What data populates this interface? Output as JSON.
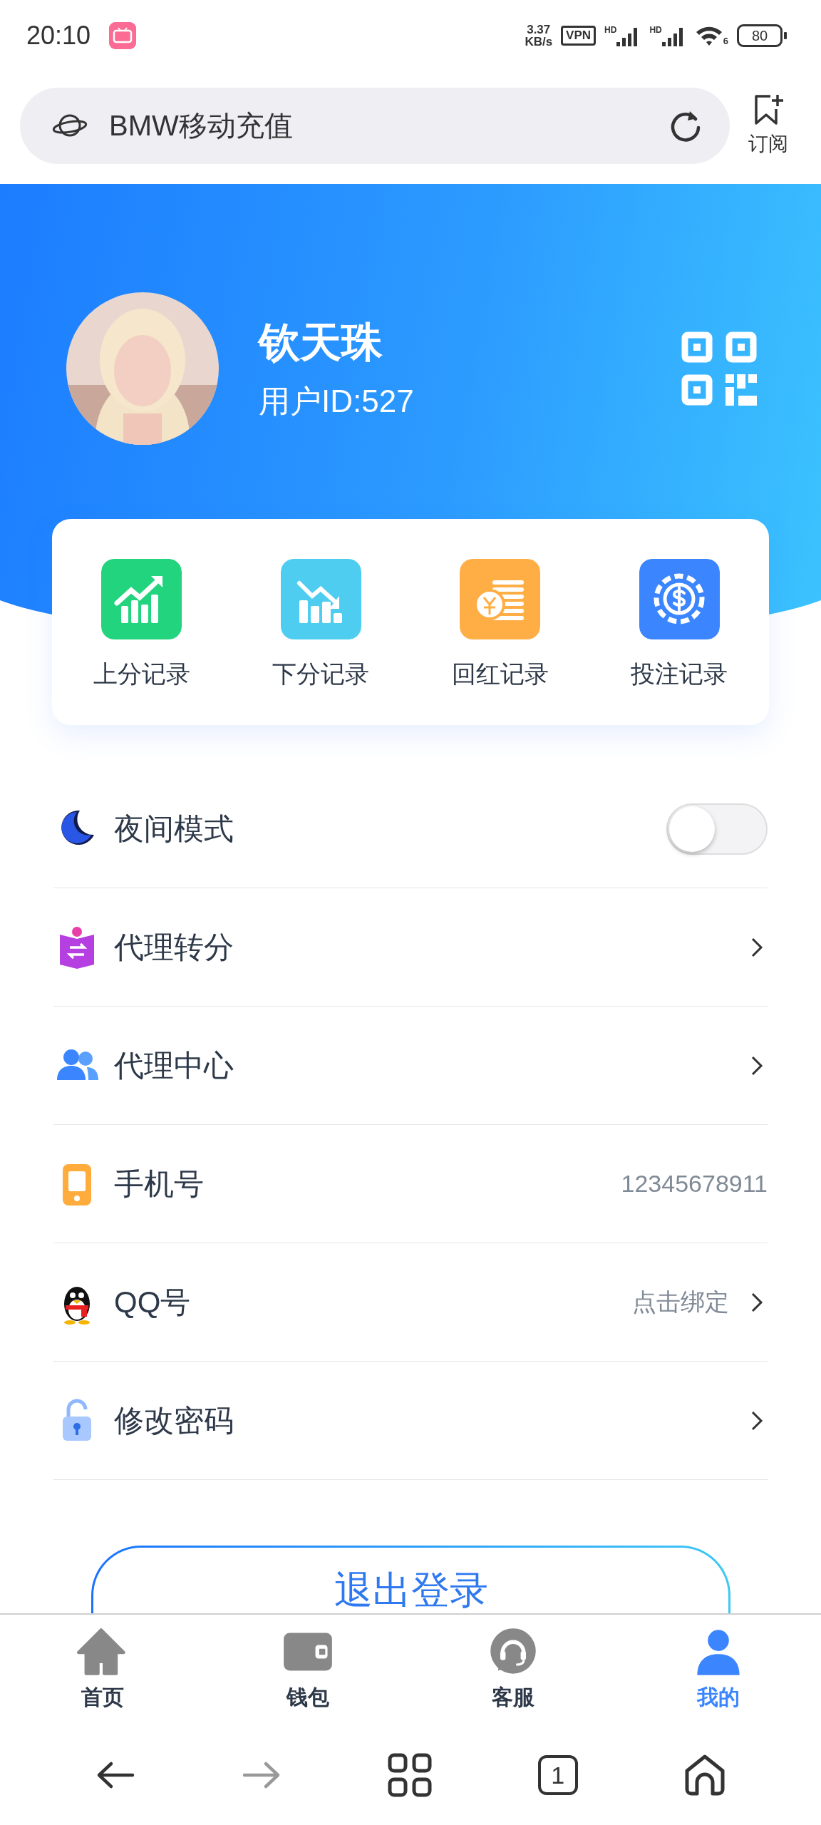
{
  "status_bar": {
    "time": "20:10",
    "speed_value": "3.37",
    "speed_unit": "KB/s",
    "vpn": "VPN",
    "sim_1": "HD",
    "sim_2": "HD",
    "wifi_generation": "6",
    "battery": "80"
  },
  "address_bar": {
    "title": "BMW移动充值"
  },
  "subscribe": {
    "label": "订阅"
  },
  "profile": {
    "name": "钦天珠",
    "user_id": "用户ID:527"
  },
  "records": [
    {
      "label": "上分记录",
      "color": "#23d47f"
    },
    {
      "label": "下分记录",
      "color": "#4ecdf0"
    },
    {
      "label": "回红记录",
      "color": "#ffae45"
    },
    {
      "label": "投注记录",
      "color": "#3b86ff"
    }
  ],
  "menu": [
    {
      "kind": "toggle",
      "label": "夜间模式",
      "on": false
    },
    {
      "kind": "link",
      "label": "代理转分"
    },
    {
      "kind": "link",
      "label": "代理中心"
    },
    {
      "kind": "value",
      "label": "手机号",
      "value": "12345678911"
    },
    {
      "kind": "link",
      "label": "QQ号",
      "value": "点击绑定"
    },
    {
      "kind": "link",
      "label": "修改密码"
    }
  ],
  "logout_button": "退出登录",
  "tab_bar": [
    {
      "label": "首页",
      "selected": false
    },
    {
      "label": "钱包",
      "selected": false
    },
    {
      "label": "客服",
      "selected": false
    },
    {
      "label": "我的",
      "selected": true
    }
  ],
  "browser_nav": {
    "tab_count": "1"
  }
}
